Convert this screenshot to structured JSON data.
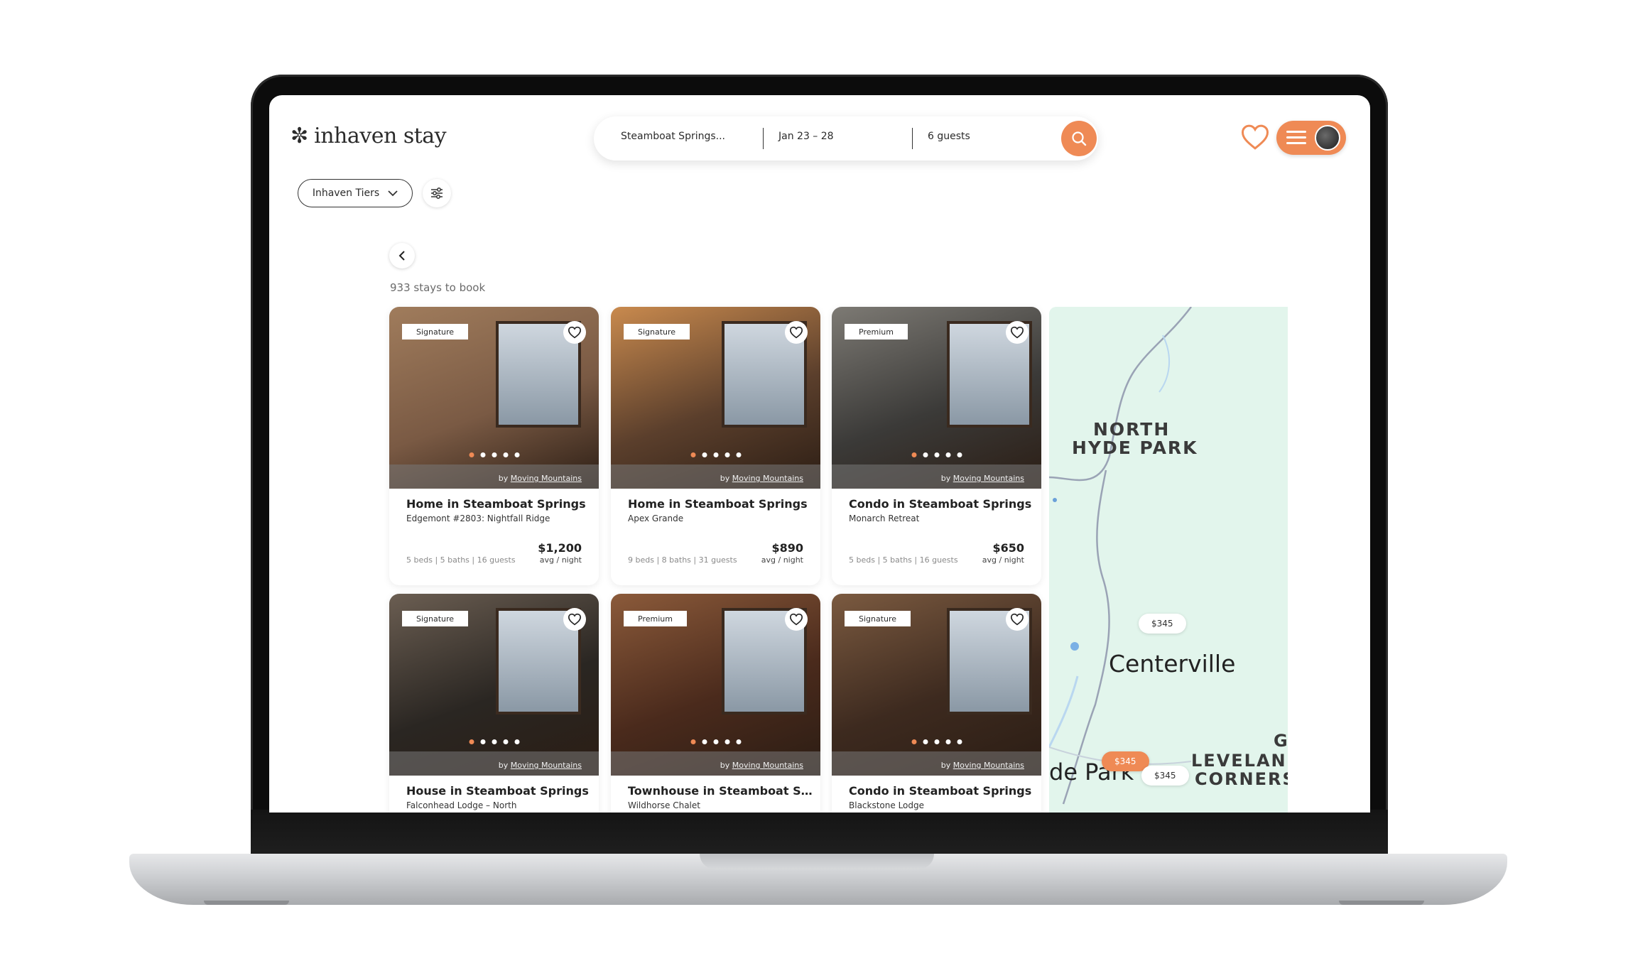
{
  "brand": {
    "name": "inhaven stay",
    "mark": "✼"
  },
  "search": {
    "location": "Steamboat Springs...",
    "dates": "Jan 23 – 28",
    "guests": "6 guests"
  },
  "filters": {
    "tiers_label": "Inhaven Tiers"
  },
  "results": {
    "count_text": "933 stays to book"
  },
  "colors": {
    "accent": "#ef8a55",
    "map_bg": "#e2f5ec"
  },
  "credit": {
    "prefix": "by",
    "name": "Moving Mountains"
  },
  "listings": [
    {
      "tier": "Signature",
      "title": "Home in Steamboat Springs",
      "subtitle": "Edgemont #2803: Nightfall Ridge",
      "meta": "5 beds | 5 baths | 16 guests",
      "price": "$1,200",
      "per": "avg / night"
    },
    {
      "tier": "Signature",
      "title": "Home in Steamboat Springs",
      "subtitle": "Apex Grande",
      "meta": "9 beds | 8 baths | 31 guests",
      "price": "$890",
      "per": "avg / night"
    },
    {
      "tier": "Premium",
      "title": "Condo in Steamboat Springs",
      "subtitle": "Monarch Retreat",
      "meta": "5 beds | 5 baths | 16 guests",
      "price": "$650",
      "per": "avg / night"
    },
    {
      "tier": "Signature",
      "title": "House in Steamboat Springs",
      "subtitle": "Falconhead Lodge – North",
      "meta": "",
      "price": "",
      "per": ""
    },
    {
      "tier": "Premium",
      "title": "Townhouse in Steamboat Spri...",
      "subtitle": "Wildhorse Chalet",
      "meta": "",
      "price": "",
      "per": ""
    },
    {
      "tier": "Signature",
      "title": "Condo in Steamboat Springs",
      "subtitle": "Blackstone Lodge",
      "meta": "",
      "price": "",
      "per": ""
    }
  ],
  "map": {
    "labels": [
      "NORTH",
      "HYDE PARK",
      "Centerville",
      "G",
      "LEVELAN",
      "CORNERS",
      "de Park"
    ],
    "pins": [
      "$345",
      "$345",
      "$345"
    ]
  }
}
